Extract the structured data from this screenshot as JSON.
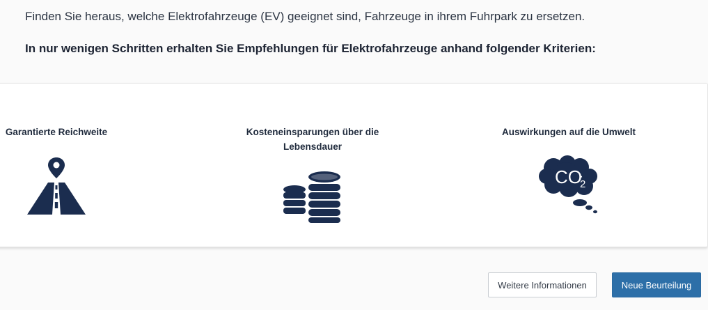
{
  "intro": {
    "text": "Finden Sie heraus, welche Elektrofahrzeuge (EV) geeignet sind, Fahrzeuge in ihrem Fuhrpark zu ersetzen.",
    "lead": "In nur wenigen Schritten erhalten Sie Empfehlungen für Elektrofahrzeuge anhand folgender Kriterien:"
  },
  "criteria": [
    {
      "label": "Garantierte Reichweite",
      "icon": "road-location-pin-icon"
    },
    {
      "label": "Kosteneinsparungen über die Lebensdauer",
      "icon": "coins-stack-icon"
    },
    {
      "label": "Auswirkungen auf die Umwelt",
      "icon": "co2-cloud-icon",
      "icon_text": "CO2"
    }
  ],
  "buttons": {
    "info": "Weitere Informationen",
    "new": "Neue Beurteilung"
  },
  "colors": {
    "icon": "#1b2d4f",
    "primary_button": "#2d6fa8"
  }
}
